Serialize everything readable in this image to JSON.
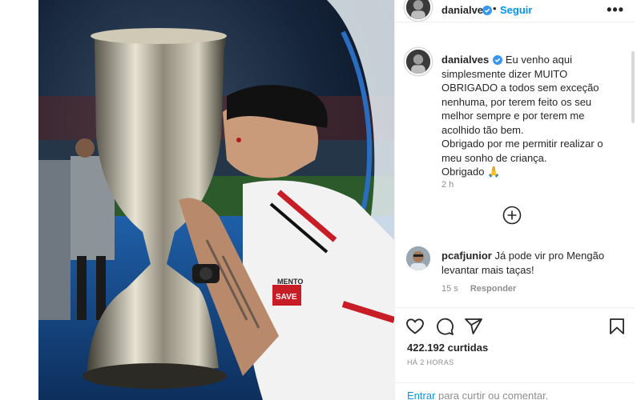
{
  "header": {
    "username": "danialves",
    "separator": "•",
    "follow_label": "Seguir",
    "more_label": "•••"
  },
  "caption": {
    "username": "danialves",
    "lines": [
      "Eu venho aqui",
      "simplesmente dizer MUITO",
      "OBRIGADO a todos sem exceção",
      "nenhuma, por terem feito os seu",
      "melhor sempre e por terem me",
      "acolhido tão bem.",
      "Obrigado por me permitir realizar o",
      "meu sonho de criança.",
      "Obrigado 🙏"
    ],
    "time": "2 h"
  },
  "comment": {
    "username": "pcafjunior",
    "text_line1": "Já pode vir pro Mengão",
    "text_line2": "levantar mais taças!",
    "time": "15 s",
    "reply_label": "Responder"
  },
  "stats": {
    "likes": "422.192 curtidas",
    "ago": "HÁ 2 HORAS"
  },
  "login": {
    "enter_label": "Entrar",
    "rest_label": " para curtir ou comentar."
  },
  "photo": {
    "shirt_sponsor_top": "MENTO",
    "shirt_sponsor_bottom": "SAVE"
  },
  "colors": {
    "link_blue": "#0095f6",
    "text": "#262626",
    "muted": "#8e8e8e"
  },
  "icons": {
    "verified": "verified-badge-icon",
    "add_comments": "plus-circle-icon",
    "like": "heart-icon",
    "comment": "comment-bubble-icon",
    "share": "paper-plane-icon",
    "save": "bookmark-icon"
  }
}
